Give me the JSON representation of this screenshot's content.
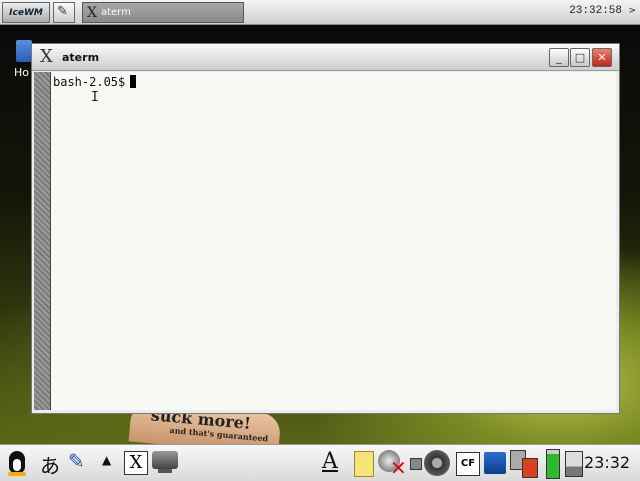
{
  "desktop": {
    "home_label": "Ho",
    "wallpaper_text": "suck more!",
    "wallpaper_subtext": "and that's guaranteed"
  },
  "top_panel": {
    "logo": "IceWM",
    "notes_glyph": "✎",
    "task": {
      "label": "aterm",
      "icon": "x-icon"
    },
    "clock": "23:32:58",
    "arrow": ">"
  },
  "window": {
    "title": "aterm",
    "buttons": {
      "minimize": "_",
      "maximize": "□",
      "close": "✕"
    },
    "prompt": "bash-2.05$",
    "ibeam": "I"
  },
  "bottom_panel": {
    "input_method": "あ",
    "pen_glyph": "✎",
    "up_arrow": "▲",
    "x_glyph": "X",
    "font_glyph": "A",
    "cf_label": "CF",
    "clock": "23:32",
    "battery_level": 0.85
  },
  "colors": {
    "terminal_bg": "#f7faf4",
    "close_button": "#c02418",
    "battery": "#2eb82e"
  }
}
